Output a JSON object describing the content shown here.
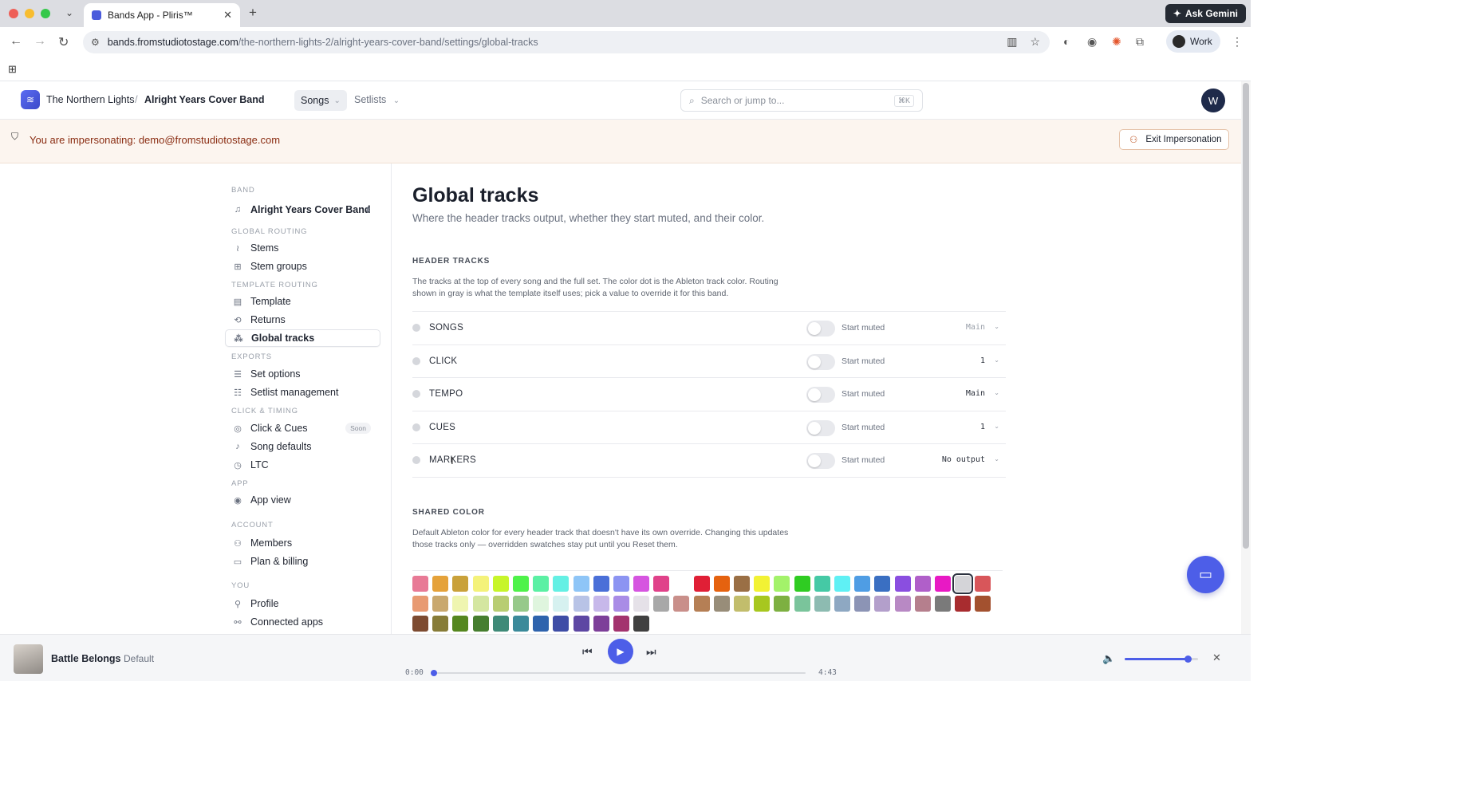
{
  "browser": {
    "tab_title": "Bands App - Pliris™",
    "url_host": "bands.fromstudiotostage.com",
    "url_path": "/the-northern-lights-2/alright-years-cover-band/settings/global-tracks",
    "gemini_label": "Ask Gemini",
    "profile_label": "Work"
  },
  "header": {
    "org": "The Northern Lights",
    "band": "Alright Years Cover Band",
    "nav_songs": "Songs",
    "nav_setlists": "Setlists",
    "search_placeholder": "Search or jump to...",
    "search_shortcut": "⌘K",
    "avatar_initial": "W"
  },
  "banner": {
    "text": "You are impersonating: demo@fromstudiotostage.com",
    "exit_label": "Exit Impersonation"
  },
  "sidebar": {
    "band_section": "BAND",
    "band_name": "Alright Years Cover Band",
    "global_routing": "GLOBAL ROUTING",
    "stems": "Stems",
    "stem_groups": "Stem groups",
    "template_routing": "TEMPLATE ROUTING",
    "template": "Template",
    "returns": "Returns",
    "global_tracks": "Global tracks",
    "exports": "EXPORTS",
    "set_options": "Set options",
    "setlist_management": "Setlist management",
    "click_timing": "CLICK & TIMING",
    "click_cues": "Click & Cues",
    "soon": "Soon",
    "song_defaults": "Song defaults",
    "ltc": "LTC",
    "app": "APP",
    "app_view": "App view",
    "account": "ACCOUNT",
    "members": "Members",
    "plan_billing": "Plan & billing",
    "you": "YOU",
    "profile": "Profile",
    "connected_apps": "Connected apps"
  },
  "main": {
    "title": "Global tracks",
    "subtitle": "Where the header tracks output, whether they start muted, and their color.",
    "header_tracks_title": "HEADER TRACKS",
    "header_tracks_desc": "The tracks at the top of every song and the full set. The color dot is the Ableton track color. Routing shown in gray is what the template itself uses; pick a value to override it for this band.",
    "start_muted_label": "Start muted",
    "tracks": [
      {
        "name": "SONGS",
        "output": "Main",
        "muted": false
      },
      {
        "name": "CLICK",
        "output": "1",
        "muted": false
      },
      {
        "name": "TEMPO",
        "output": "Main",
        "muted": false
      },
      {
        "name": "CUES",
        "output": "1",
        "muted": false
      },
      {
        "name": "MARKERS",
        "output": "No output",
        "muted": false
      }
    ],
    "shared_color_title": "SHARED COLOR",
    "shared_color_desc": "Default Ableton color for every header track that doesn't have its own override. Changing this updates those tracks only — overridden swatches stay put until you Reset them.",
    "swatch_rows": [
      [
        "#e87a96",
        "#e5a23a",
        "#c9a13a",
        "#f4f27a",
        "#c7f52a",
        "#4ef24a",
        "#5bf0a4",
        "#64f0e4",
        "#8ec5f7",
        "#4a6fd8",
        "#8c94f2",
        "#d655e0",
        "#e0428a",
        "#ffffff",
        "#e01f36",
        "#e5620f",
        "#9a6f45",
        "#f2f234",
        "#a3f26a",
        "#2fcc22",
        "#45c9a5",
        "#5ff0f4",
        "#4f9de4",
        "#3a6fc2",
        "#8a4ee0",
        "#b05fc9",
        "#e819c4",
        "#d4d4d8",
        "#d8565a"
      ],
      [
        "#e89a72",
        "#c9a86e",
        "#eff5b0",
        "#d4e6a0",
        "#b8cd72",
        "#96c98a",
        "#dff5de",
        "#d6f1f0",
        "#b8c3e6",
        "#c7b8ea",
        "#a98ce6",
        "#e5e1e8",
        "#a8a8a8",
        "#c98f8a",
        "#b57f55",
        "#988d79",
        "#c2bd6c",
        "#a7c71f",
        "#7db041",
        "#7ac49b",
        "#8dbbb1",
        "#8ea8c2",
        "#8c94b5",
        "#b39fcb",
        "#b889c4",
        "#b57f8d",
        "#7a7a7a",
        "#a82c2f",
        "#a3512f"
      ],
      [
        "#7d4b31",
        "#877c38",
        "#55871f",
        "#467e2f",
        "#3f8a78",
        "#3b8a9a",
        "#2e63ad",
        "#3e4da6",
        "#5d47a3",
        "#7d3f99",
        "#a3336e",
        "#404040"
      ]
    ],
    "selected_swatch": "#d4d4d8"
  },
  "player": {
    "song": "Battle Belongs",
    "variant": "Default",
    "current_time": "0:00",
    "duration": "4:43",
    "progress_fraction": 0.0,
    "volume_fraction": 0.86
  }
}
